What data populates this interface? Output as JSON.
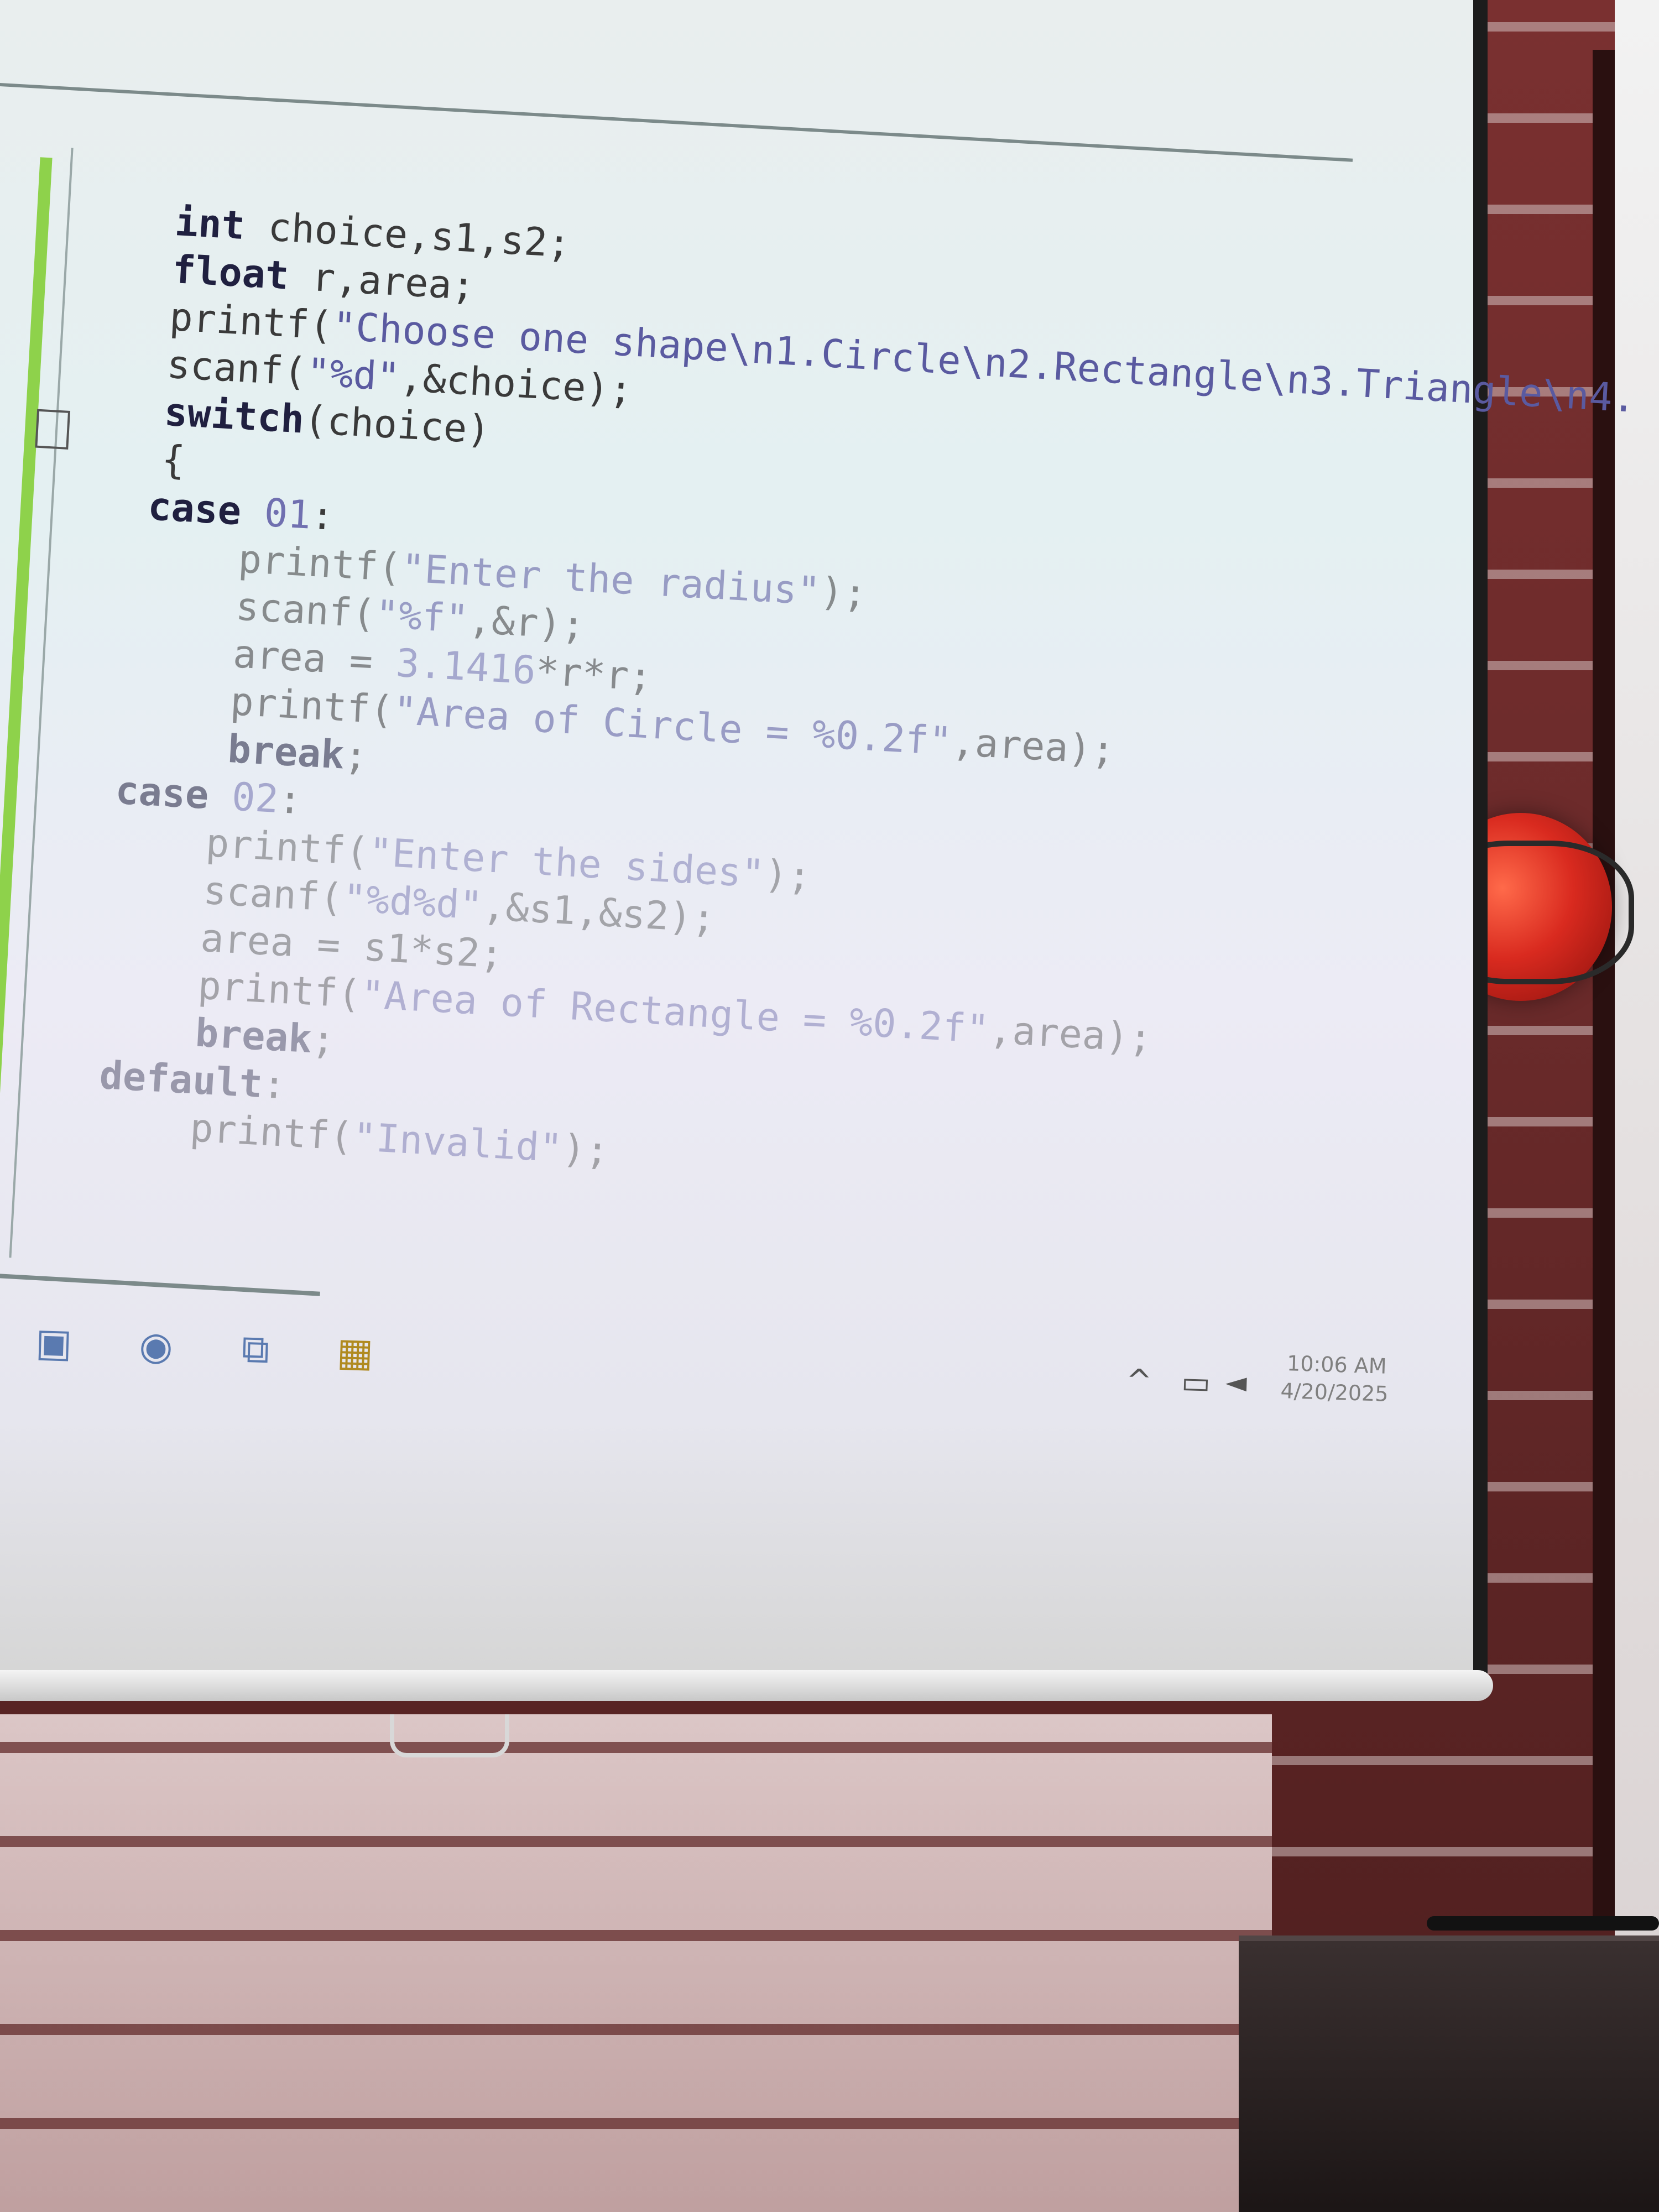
{
  "editor": {
    "code_lines": [
      {
        "parts": [
          {
            "t": "int",
            "c": "kw"
          },
          {
            "t": " choice,s1,s2;",
            "c": ""
          }
        ]
      },
      {
        "parts": [
          {
            "t": "float",
            "c": "kw"
          },
          {
            "t": " r,area;",
            "c": ""
          }
        ]
      },
      {
        "parts": [
          {
            "t": "printf(",
            "c": ""
          },
          {
            "t": "\"Choose one shape\\n1.Circle\\n2.Rectangle\\n3.Triangle\\n4.",
            "c": "str"
          }
        ]
      },
      {
        "parts": [
          {
            "t": "scanf(",
            "c": ""
          },
          {
            "t": "\"%d\"",
            "c": "str"
          },
          {
            "t": ",&choice);",
            "c": ""
          }
        ]
      },
      {
        "parts": [
          {
            "t": "switch",
            "c": "kw"
          },
          {
            "t": "(choice)",
            "c": ""
          }
        ]
      },
      {
        "parts": [
          {
            "t": "{",
            "c": ""
          }
        ]
      },
      {
        "parts": [
          {
            "t": "case",
            "c": "kw"
          },
          {
            "t": " 01",
            "c": "num"
          },
          {
            "t": ":",
            "c": ""
          }
        ]
      },
      {
        "parts": [
          {
            "t": "    printf(",
            "c": ""
          },
          {
            "t": "\"Enter the radius\"",
            "c": "str"
          },
          {
            "t": ");",
            "c": ""
          }
        ]
      },
      {
        "parts": [
          {
            "t": "    scanf(",
            "c": ""
          },
          {
            "t": "\"%f\"",
            "c": "str"
          },
          {
            "t": ",&r);",
            "c": ""
          }
        ]
      },
      {
        "parts": [
          {
            "t": "    area = ",
            "c": ""
          },
          {
            "t": "3.1416",
            "c": "num"
          },
          {
            "t": "*r*r;",
            "c": ""
          }
        ]
      },
      {
        "parts": [
          {
            "t": "    printf(",
            "c": ""
          },
          {
            "t": "\"Area of Circle = %0.2f\"",
            "c": "str"
          },
          {
            "t": ",area);",
            "c": ""
          }
        ]
      },
      {
        "parts": [
          {
            "t": "    break",
            "c": "kw"
          },
          {
            "t": ";",
            "c": ""
          }
        ]
      },
      {
        "parts": [
          {
            "t": "case",
            "c": "kw"
          },
          {
            "t": " 02",
            "c": "num"
          },
          {
            "t": ":",
            "c": ""
          }
        ]
      },
      {
        "parts": [
          {
            "t": "    printf(",
            "c": ""
          },
          {
            "t": "\"Enter the sides\"",
            "c": "str"
          },
          {
            "t": ");",
            "c": ""
          }
        ]
      },
      {
        "parts": [
          {
            "t": "    scanf(",
            "c": ""
          },
          {
            "t": "\"%d%d\"",
            "c": "str"
          },
          {
            "t": ",&s1,&s2);",
            "c": ""
          }
        ]
      },
      {
        "parts": [
          {
            "t": "    area = s1*s2;",
            "c": ""
          }
        ]
      },
      {
        "parts": [
          {
            "t": "    printf(",
            "c": ""
          },
          {
            "t": "\"Area of Rectangle = %0.2f\"",
            "c": "str"
          },
          {
            "t": ",area);",
            "c": ""
          }
        ]
      },
      {
        "parts": [
          {
            "t": "    break",
            "c": "kw"
          },
          {
            "t": ";",
            "c": ""
          }
        ]
      },
      {
        "parts": [
          {
            "t": "default",
            "c": "kw"
          },
          {
            "t": ":",
            "c": ""
          }
        ]
      },
      {
        "parts": [
          {
            "t": "    printf(",
            "c": ""
          },
          {
            "t": "\"Invalid\"",
            "c": "str"
          },
          {
            "t": ");",
            "c": ""
          }
        ]
      }
    ]
  },
  "taskbar": {
    "icons": [
      "app-icon",
      "chrome-icon",
      "copy-icon",
      "codeblocks-icon"
    ],
    "tray": {
      "chevron": "^",
      "time": "10:06 AM",
      "date": "4/20/2025"
    }
  }
}
